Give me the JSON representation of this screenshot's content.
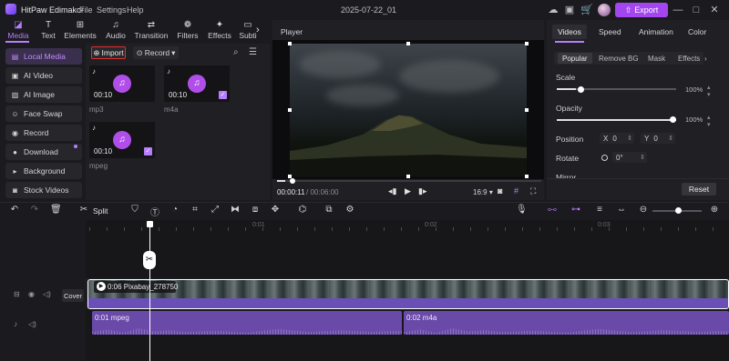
{
  "app": {
    "title": "HitPaw Edimakor",
    "menus": [
      "File",
      "Settings",
      "Help"
    ],
    "project_title": "2025-07-22_01",
    "export_label": "Export"
  },
  "media_tabs": [
    {
      "label": "Media",
      "icon": "media-icon"
    },
    {
      "label": "Text",
      "icon": "text-icon"
    },
    {
      "label": "Elements",
      "icon": "elements-icon"
    },
    {
      "label": "Audio",
      "icon": "audio-icon"
    },
    {
      "label": "Transition",
      "icon": "transition-icon"
    },
    {
      "label": "Filters",
      "icon": "filters-icon"
    },
    {
      "label": "Effects",
      "icon": "effects-icon"
    },
    {
      "label": "Subti",
      "icon": "subtitles-icon"
    }
  ],
  "sidebar": {
    "items": [
      "Local Media",
      "AI Video",
      "AI Image",
      "Face Swap",
      "Record",
      "Download",
      "Background",
      "Stock Videos"
    ]
  },
  "media": {
    "import_label": "Import",
    "record_label": "Record",
    "items": [
      {
        "duration": "00:10",
        "label": "mp3",
        "checked": false
      },
      {
        "duration": "00:10",
        "label": "m4a",
        "checked": true
      },
      {
        "duration": "00:10",
        "label": "mpeg",
        "checked": true
      }
    ]
  },
  "player": {
    "title": "Player",
    "current_time": "00:00:11",
    "total_time": "/ 00:06:00",
    "aspect": "16:9",
    "progress": 0.03
  },
  "right_panel": {
    "tabs": [
      "Videos",
      "Speed",
      "Animation",
      "Color"
    ],
    "sub_tabs": [
      "Popular",
      "Remove BG",
      "Mask",
      "Effects"
    ],
    "scale": {
      "label": "Scale",
      "value": "100%",
      "level": 0.16
    },
    "opacity": {
      "label": "Opacity",
      "value": "100%",
      "level": 1.0
    },
    "position": {
      "label": "Position",
      "x_label": "X",
      "x": "0",
      "y_label": "Y",
      "y": "0"
    },
    "rotate": {
      "label": "Rotate",
      "value": "0°"
    },
    "mirror": {
      "label": "Mirror"
    },
    "reset_label": "Reset"
  },
  "toolbar": {
    "split_label": "Split"
  },
  "timeline": {
    "ruler": [
      "0:01",
      "0:02",
      "0:03"
    ],
    "cover_label": "Cover",
    "video_clip": {
      "label": "0:06 Pixabay_278750"
    },
    "audio_clips": [
      {
        "label": "0:01 mpeg"
      },
      {
        "label": "0:02 m4a"
      }
    ]
  }
}
